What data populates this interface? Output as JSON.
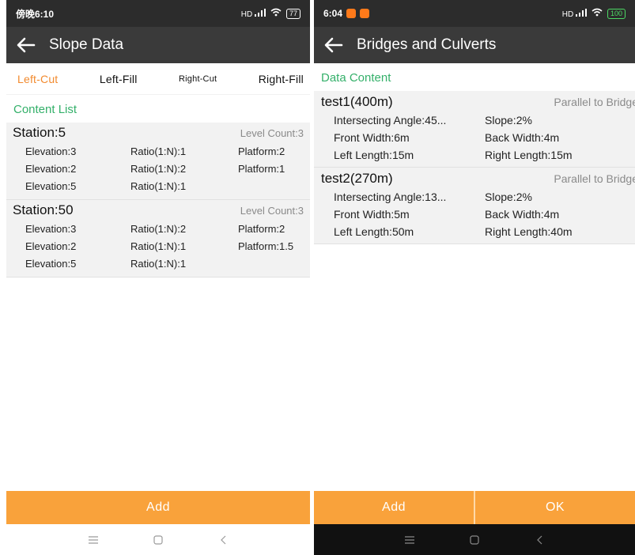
{
  "left": {
    "status": {
      "time": "傍晚6:10",
      "signal": "HD",
      "battery": "77"
    },
    "title": "Slope Data",
    "tabs": [
      "Left-Cut",
      "Left-Fill",
      "Right-Cut",
      "Right-Fill"
    ],
    "section_title": "Content List",
    "stations": [
      {
        "name": "Station:5",
        "level_count": "Level Count:3",
        "rows": [
          {
            "elevation": "Elevation:3",
            "ratio": "Ratio(1:N):1",
            "platform": "Platform:2"
          },
          {
            "elevation": "Elevation:2",
            "ratio": "Ratio(1:N):2",
            "platform": "Platform:1"
          },
          {
            "elevation": "Elevation:5",
            "ratio": "Ratio(1:N):1",
            "platform": ""
          }
        ]
      },
      {
        "name": "Station:50",
        "level_count": "Level Count:3",
        "rows": [
          {
            "elevation": "Elevation:3",
            "ratio": "Ratio(1:N):2",
            "platform": "Platform:2"
          },
          {
            "elevation": "Elevation:2",
            "ratio": "Ratio(1:N):1",
            "platform": "Platform:1.5"
          },
          {
            "elevation": "Elevation:5",
            "ratio": "Ratio(1:N):1",
            "platform": ""
          }
        ]
      }
    ],
    "add_label": "Add"
  },
  "right": {
    "status": {
      "time": "6:04",
      "signal": "HD",
      "battery": "100"
    },
    "title": "Bridges and Culverts",
    "section_title": "Data Content",
    "bridges": [
      {
        "name": "test1(400m)",
        "type": "Parallel to Bridge",
        "angle": "Intersecting Angle:45...",
        "slope": "Slope:2%",
        "front": "Front Width:6m",
        "back": "Back Width:4m",
        "left_len": "Left Length:15m",
        "right_len": "Right Length:15m"
      },
      {
        "name": "test2(270m)",
        "type": "Parallel to Bridge",
        "angle": "Intersecting Angle:13...",
        "slope": "Slope:2%",
        "front": "Front Width:5m",
        "back": "Back Width:4m",
        "left_len": "Left Length:50m",
        "right_len": "Right Length:40m"
      }
    ],
    "add_label": "Add",
    "ok_label": "OK"
  },
  "colors": {
    "accent_orange": "#f9a23b",
    "tab_active": "#f28a2e",
    "section_green": "#34b06a",
    "app_bar": "#3a3a3a"
  }
}
